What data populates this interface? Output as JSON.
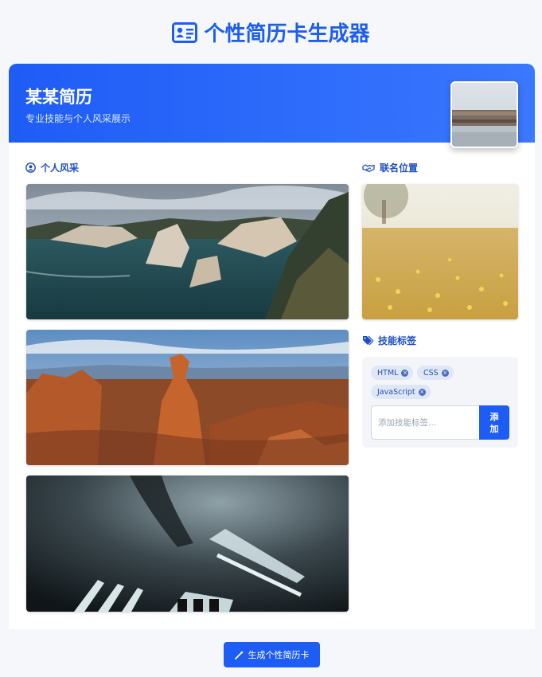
{
  "app": {
    "title": "个性简历卡生成器"
  },
  "header": {
    "title": "某某简历",
    "subtitle": "专业技能与个人风采展示"
  },
  "sections": {
    "gallery": "个人风采",
    "location": "联名位置",
    "skills": "技能标签"
  },
  "skills": {
    "tags": [
      "HTML",
      "CSS",
      "JavaScript"
    ],
    "input_placeholder": "添加技能标签...",
    "add_button": "添加"
  },
  "footer": {
    "generate_button": "生成个性简历卡"
  },
  "colors": {
    "primary": "#1e5cf6",
    "title": "#1d5ef0",
    "section": "#1d4fc0"
  }
}
